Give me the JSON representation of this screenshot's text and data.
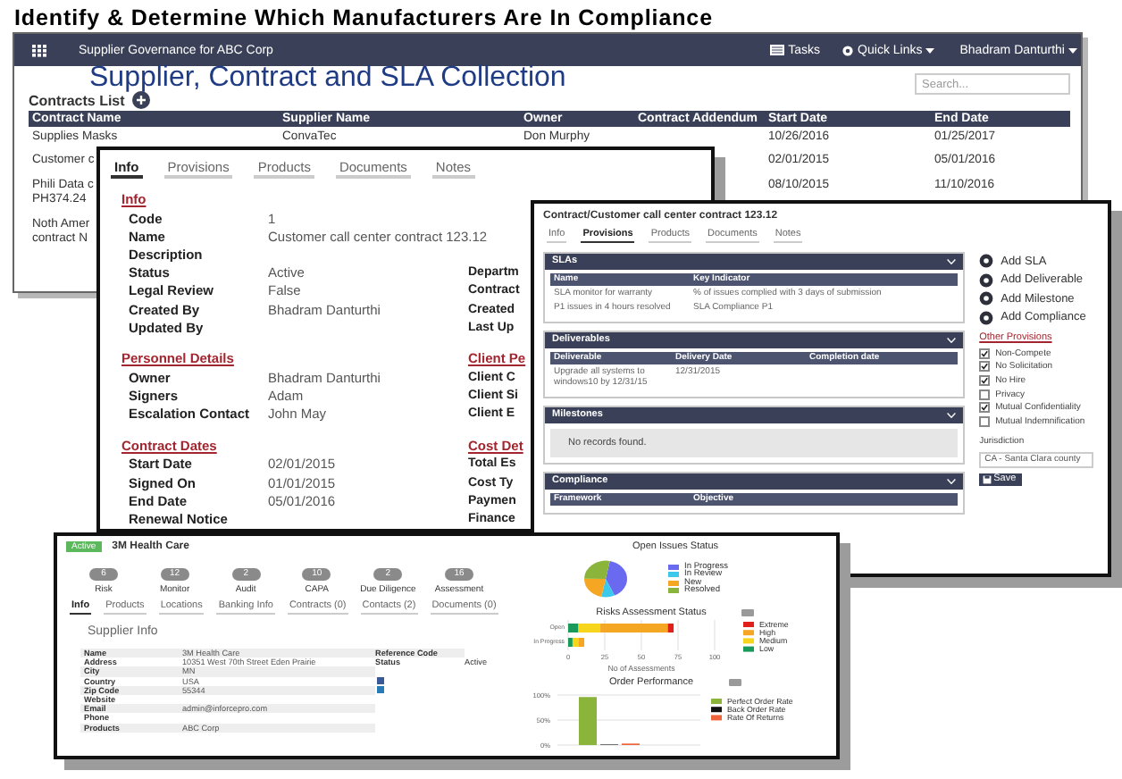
{
  "slide_title": "Identify & Determine Which Manufacturers Are In Compliance",
  "caption": "Supplier, Contract and SLA Collection",
  "contracts_window": {
    "app_title": "Supplier Governance for ABC Corp",
    "header_links": [
      {
        "kind": "tasks",
        "label": "Tasks"
      },
      {
        "kind": "quick_links",
        "label": "Quick Links"
      },
      {
        "kind": "user",
        "label": "Bhadram Danturthi"
      }
    ],
    "list_title": "Contracts List",
    "search": {
      "placeholder": "Search..."
    },
    "columns": [
      "Contract Name",
      "Supplier Name",
      "Owner",
      "Contract Addendum",
      "Start Date",
      "End Date"
    ],
    "rows": [
      {
        "contract_name": "Supplies Masks",
        "supplier_name": "ConvaTec",
        "owner": "Don Murphy",
        "start_date": "10/26/2016",
        "end_date": "01/25/2017"
      },
      {
        "contract_name": "Customer c",
        "start_date": "02/01/2015",
        "end_date": "05/01/2016"
      },
      {
        "contract_name": "Phili Data c\nPH374.24",
        "start_date": "08/10/2015",
        "end_date": "11/10/2016"
      },
      {
        "contract_name": "Noth Amer\ncontract N"
      }
    ]
  },
  "contract_info_window": {
    "tabs": [
      {
        "label": "Info",
        "selected": true
      },
      {
        "label": "Provisions",
        "selected": false
      },
      {
        "label": "Products",
        "selected": false
      },
      {
        "label": "Documents",
        "selected": false
      },
      {
        "label": "Notes",
        "selected": false
      }
    ],
    "sections": [
      {
        "title": "Info",
        "fields": [
          {
            "label": "Code",
            "value": "1"
          },
          {
            "label": "Name",
            "value": "Customer call center contract 123.12"
          },
          {
            "label": "Description"
          },
          {
            "label": "Status",
            "value": "Active",
            "side_label": "Departm"
          },
          {
            "label": "Legal Review",
            "value": "False",
            "side_label": "Contract"
          },
          {
            "label": "Created By",
            "value": "Bhadram Danturthi",
            "side_label": "Created"
          },
          {
            "label": "Updated By",
            "side_label": "Last Up"
          }
        ]
      },
      {
        "title": "Personnel Details",
        "side_title": "Client Pe",
        "fields": [
          {
            "label": "Owner",
            "value": "Bhadram Danturthi",
            "side_label": "Client C"
          },
          {
            "label": "Signers",
            "value": "Adam",
            "side_label": "Client Si"
          },
          {
            "label": "Escalation Contact",
            "value": "John May",
            "side_label": "Client E"
          }
        ]
      },
      {
        "title": "Contract Dates",
        "side_title": "Cost Det",
        "fields": [
          {
            "label": "Start Date",
            "value": "02/01/2015",
            "side_label": "Total Es"
          },
          {
            "label": "Signed On",
            "value": "01/01/2015",
            "side_label": "Cost Ty"
          },
          {
            "label": "End Date",
            "value": "05/01/2016",
            "side_label": "Paymen"
          },
          {
            "label": "Renewal Notice",
            "side_label": "Finance"
          }
        ]
      }
    ]
  },
  "provisions_window": {
    "title": "Contract/Customer call center contract 123.12",
    "tabs": [
      {
        "label": "Info",
        "selected": false
      },
      {
        "label": "Provisions",
        "selected": true
      },
      {
        "label": "Products",
        "selected": false
      },
      {
        "label": "Documents",
        "selected": false
      },
      {
        "label": "Notes",
        "selected": false
      }
    ],
    "panels": [
      {
        "kind": "table",
        "title": "SLAs",
        "columns": [
          "Name",
          "Key Indicator"
        ],
        "rows": [
          [
            "SLA monitor for warranty",
            "% of issues complied with 3 days of submission"
          ],
          [
            "P1 issues in 4 hours resolved",
            "SLA Compliance P1"
          ]
        ]
      },
      {
        "kind": "table",
        "title": "Deliverables",
        "columns": [
          "Deliverable",
          "Delivery Date",
          "Completion date"
        ],
        "rows": [
          [
            "Upgrade all systems to windows10 by 12/31/15",
            "12/31/2015"
          ]
        ]
      },
      {
        "kind": "empty",
        "title": "Milestones",
        "message": "No records found."
      },
      {
        "kind": "table",
        "title": "Compliance",
        "columns": [
          "Framework",
          "Objective"
        ]
      }
    ],
    "actions": [
      "Add SLA",
      "Add Deliverable",
      "Add Milestone",
      "Add Compliance"
    ],
    "other_provisions": {
      "title": "Other Provisions",
      "options": [
        {
          "label": "Non-Compete",
          "checked": true
        },
        {
          "label": "No Solicitation",
          "checked": true
        },
        {
          "label": "No Hire",
          "checked": true
        },
        {
          "label": "Privacy",
          "checked": false
        },
        {
          "label": "Mutual Confidentiality",
          "checked": true
        },
        {
          "label": "Mutual Indemnification",
          "checked": false
        }
      ]
    },
    "jurisdiction": {
      "label": "Jurisdiction",
      "value": "CA - Santa Clara county"
    },
    "save_button": "Save"
  },
  "supplier_window": {
    "status_badge": "Active",
    "name": "3M Health Care",
    "scores": [
      {
        "count": "6",
        "label": "Risk"
      },
      {
        "count": "12",
        "label": "Monitor"
      },
      {
        "count": "2",
        "label": "Audit"
      },
      {
        "count": "10",
        "label": "CAPA"
      },
      {
        "count": "2",
        "label": "Due Diligence"
      },
      {
        "count": "16",
        "label": "Assessment"
      }
    ],
    "tabs": [
      {
        "label": "Info",
        "selected": true
      },
      {
        "label": "Products",
        "selected": false
      },
      {
        "label": "Locations",
        "selected": false
      },
      {
        "label": "Banking Info",
        "selected": false
      },
      {
        "label": "Contracts (0)",
        "selected": false
      },
      {
        "label": "Contacts (2)",
        "selected": false
      },
      {
        "label": "Documents (0)",
        "selected": false
      }
    ],
    "section_title": "Supplier Info",
    "fields": [
      {
        "label": "Name",
        "value": "3M Health Care"
      },
      {
        "label": "Address",
        "value": "10351 West 70th Street Eden Prairie"
      },
      {
        "label": "City",
        "value": "MN"
      },
      {
        "label": "Country",
        "value": "USA"
      },
      {
        "label": "Zip Code",
        "value": "55344"
      },
      {
        "label": "Website"
      },
      {
        "label": "Email",
        "value": "admin@inforcepro.com"
      },
      {
        "label": "Phone"
      },
      {
        "label": "Products",
        "value": "ABC Corp"
      }
    ],
    "side_fields": [
      {
        "label": "Reference Code"
      },
      {
        "label": "Status",
        "value": "Active"
      }
    ],
    "open_issues": {
      "title": "Open Issues Status",
      "legend": [
        {
          "label": "In Progress",
          "color": "#6a6af0"
        },
        {
          "label": "In Review",
          "color": "#3cc8ea"
        },
        {
          "label": "New",
          "color": "#f5a623"
        },
        {
          "label": "Resolved",
          "color": "#8ab53a"
        }
      ]
    },
    "risks": {
      "chart_data": {
        "type": "bar",
        "orientation": "horizontal",
        "stacked": true,
        "title": "Risks Assessment Status",
        "xlabel": "No of Assessments",
        "categories": [
          "Open",
          "In Progress"
        ],
        "xlim": [
          0,
          100
        ],
        "grid": true,
        "legend": "right",
        "xticks": [
          0,
          25,
          50,
          75,
          100
        ],
        "series": [
          {
            "name": "Low",
            "color": "#1a9a5a",
            "values": [
              7,
              3
            ]
          },
          {
            "name": "Medium",
            "color": "#f7d51d",
            "values": [
              15,
              4
            ]
          },
          {
            "name": "High",
            "color": "#f5a623",
            "values": [
              46,
              4
            ]
          },
          {
            "name": "Extreme",
            "color": "#e0201b",
            "values": [
              4,
              0
            ]
          }
        ]
      }
    },
    "order_performance": {
      "chart_data": {
        "type": "bar",
        "title": "Order Performance",
        "ylim": [
          0,
          100
        ],
        "grid": true,
        "legend": "right",
        "yticks": [
          {
            "value": 100,
            "label": "100%"
          },
          {
            "value": 50,
            "label": "50%"
          },
          {
            "value": 0,
            "label": "0%"
          }
        ],
        "series": [
          {
            "name": "Perfect Order Rate",
            "color": "#8ab53a",
            "values": [
              96
            ]
          },
          {
            "name": "Back Order Rate",
            "color": "#111111",
            "values": [
              1
            ]
          },
          {
            "name": "Rate Of Returns",
            "color": "#f0643c",
            "values": [
              3
            ]
          }
        ]
      }
    }
  }
}
